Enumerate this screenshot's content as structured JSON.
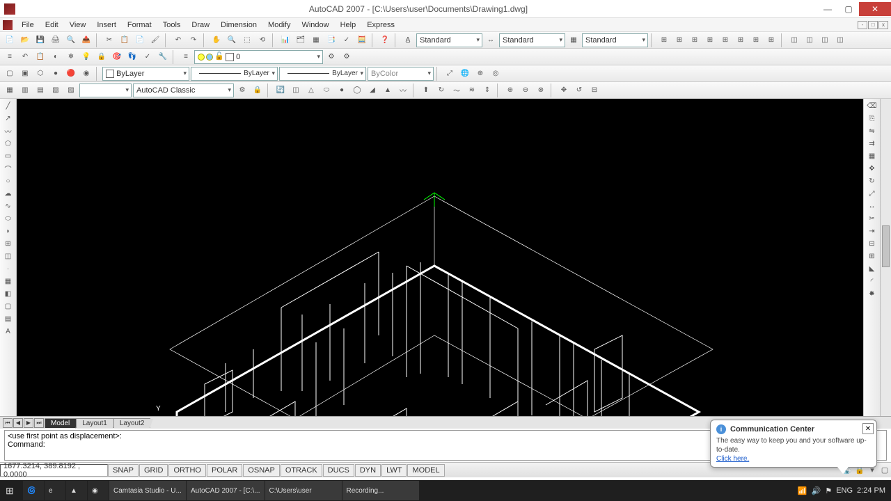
{
  "window": {
    "title": "AutoCAD 2007 - [C:\\Users\\user\\Documents\\Drawing1.dwg]"
  },
  "menu": {
    "items": [
      "File",
      "Edit",
      "View",
      "Insert",
      "Format",
      "Tools",
      "Draw",
      "Dimension",
      "Modify",
      "Window",
      "Help",
      "Express"
    ]
  },
  "styles": {
    "textstyle": "Standard",
    "dimstyle": "Standard",
    "tablestyle": "Standard"
  },
  "layers": {
    "current": "0"
  },
  "props": {
    "layer": "ByLayer",
    "linetype": "ByLayer",
    "lineweight": "ByLayer",
    "plotstyle": "ByColor"
  },
  "workspace": {
    "current": "AutoCAD Classic"
  },
  "tabs": {
    "items": [
      "Model",
      "Layout1",
      "Layout2"
    ],
    "active": 0
  },
  "cmd": {
    "line1": "<use first point as displacement>:",
    "line2": "Command:"
  },
  "status": {
    "coords": "1677.3214, 389.8192 , 0.0000",
    "toggles": [
      "SNAP",
      "GRID",
      "ORTHO",
      "POLAR",
      "OSNAP",
      "OTRACK",
      "DUCS",
      "DYN",
      "LWT",
      "MODEL"
    ]
  },
  "popup": {
    "title": "Communication Center",
    "body": "The easy way to keep you and your software up-to-date.",
    "link": "Click here."
  },
  "taskbar": {
    "apps": [
      "Camtasia Studio - U...",
      "AutoCAD 2007 - [C:\\...",
      "C:\\Users\\user",
      "Recording..."
    ],
    "lang": "ENG",
    "time": "2:24 PM"
  },
  "ucs": {
    "y": "Y"
  }
}
